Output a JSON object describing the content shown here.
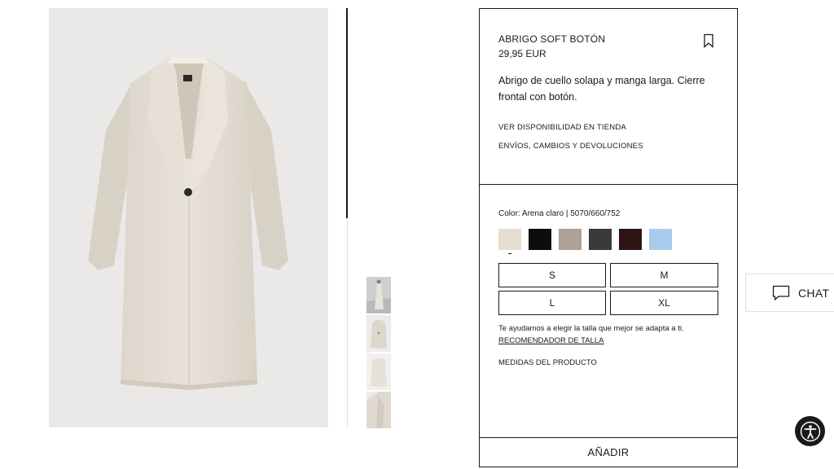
{
  "product": {
    "title": "ABRIGO SOFT BOTÓN",
    "price": "29,95 EUR",
    "description": "Abrigo de cuello solapa y manga larga. Cierre frontal con botón.",
    "availability_link": "VER DISPONIBILIDAD EN TIENDA",
    "shipping_link": "ENVÍOS, CAMBIOS Y DEVOLUCIONES"
  },
  "color": {
    "label": "Color: Arena claro | 5070/660/752",
    "swatches": [
      {
        "name": "Arena claro",
        "hex": "#e6ddd1",
        "selected": true
      },
      {
        "name": "Negro",
        "hex": "#0d0d0d",
        "selected": false
      },
      {
        "name": "Topo",
        "hex": "#aea196",
        "selected": false
      },
      {
        "name": "Gris oscuro",
        "hex": "#3a3a3a",
        "selected": false
      },
      {
        "name": "Burdeos",
        "hex": "#2e1414",
        "selected": false
      },
      {
        "name": "Azul claro",
        "hex": "#a8cbee",
        "selected": false
      }
    ]
  },
  "sizes": [
    "S",
    "M",
    "L",
    "XL"
  ],
  "size_help": {
    "text": "Te ayudamos a elegir la talla que mejor se adapta a ti.",
    "recommender": "RECOMENDADOR DE TALLA",
    "measures": "MEDIDAS DEL PRODUCTO"
  },
  "add_button": "AÑADIR",
  "chat": {
    "label": "CHAT",
    "icon": "chat-bubble-icon"
  },
  "accessibility": {
    "icon": "accessibility-icon"
  },
  "icons": {
    "bookmark": "bookmark-icon"
  },
  "colors": {
    "text": "#1a1a1a",
    "image_bg": "#ebe9e8",
    "coat": "#e3ddd4"
  }
}
